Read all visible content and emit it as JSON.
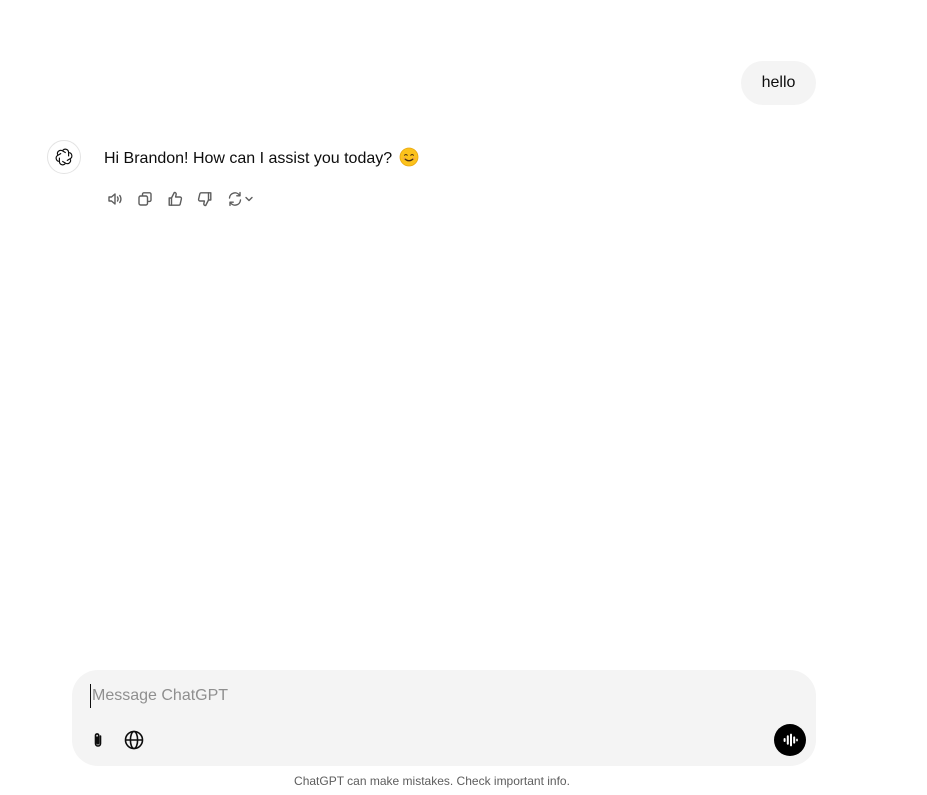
{
  "conversation": {
    "user_message": "hello",
    "assistant_message": "Hi Brandon! How can I assist you today?",
    "assistant_emoji_icon": "smiling-face-icon"
  },
  "message_actions": [
    {
      "name": "read-aloud",
      "icon": "speaker-icon"
    },
    {
      "name": "copy",
      "icon": "copy-icon"
    },
    {
      "name": "good-response",
      "icon": "thumbs-up-icon"
    },
    {
      "name": "bad-response",
      "icon": "thumbs-down-icon"
    },
    {
      "name": "regenerate",
      "icon": "refresh-icon"
    }
  ],
  "composer": {
    "placeholder": "Message ChatGPT",
    "value": "",
    "attach_icon": "paperclip-icon",
    "search_icon": "globe-icon",
    "voice_icon": "voice-waveform-icon"
  },
  "footer": {
    "disclaimer": "ChatGPT can make mistakes. Check important info."
  },
  "colors": {
    "bubble_bg": "#f4f4f4",
    "composer_bg": "#f4f4f4",
    "text": "#0d0d0d",
    "muted": "#5d5d5d",
    "voice_button": "#000000"
  }
}
